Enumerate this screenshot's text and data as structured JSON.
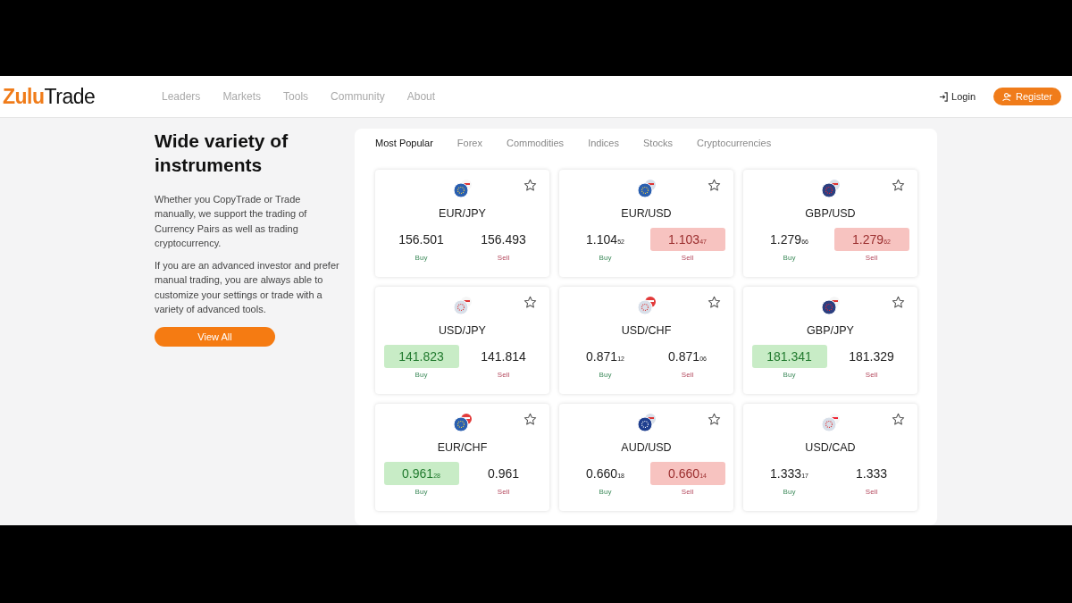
{
  "header": {
    "logo": {
      "accent": "Zulu",
      "rest": "Trade"
    },
    "nav": [
      {
        "label": "Leaders"
      },
      {
        "label": "Markets"
      },
      {
        "label": "Tools"
      },
      {
        "label": "Community"
      },
      {
        "label": "About"
      }
    ],
    "login": "Login",
    "register": "Register"
  },
  "intro": {
    "title": "Wide variety of instruments",
    "paragraphs": [
      "Whether you CopyTrade or Trade manually, we support the trading of Currency Pairs as well as trading cryptocurrency.",
      "If you are an advanced investor and prefer manual trading, you are always able to customize your settings or trade with a variety of advanced tools."
    ],
    "button": "View All"
  },
  "tabs": [
    {
      "label": "Most Popular",
      "selected": true
    },
    {
      "label": "Forex",
      "selected": false
    },
    {
      "label": "Commodities",
      "selected": false
    },
    {
      "label": "Indices",
      "selected": false
    },
    {
      "label": "Stocks",
      "selected": false
    },
    {
      "label": "Cryptocurrencies",
      "selected": false
    }
  ],
  "instruments": [
    {
      "pair": "EUR/JPY",
      "buy": {
        "price": "156.501",
        "label": "Buy",
        "highlighted": false
      },
      "sell": {
        "price": "156.493",
        "label": "Sell",
        "highlighted": false
      }
    },
    {
      "pair": "EUR/USD",
      "buy": {
        "price": "1.104$_{52}$",
        "label": "Buy",
        "highlighted": false
      },
      "sell": {
        "price": "1.103$_{47}$",
        "label": "Sell",
        "highlighted": true
      }
    },
    {
      "pair": "GBP/USD",
      "buy": {
        "price": "1.279$_{66}$",
        "label": "Buy",
        "highlighted": false
      },
      "sell": {
        "price": "1.279$_{62}$",
        "label": "Sell",
        "highlighted": true
      }
    },
    {
      "pair": "USD/JPY",
      "buy": {
        "price": "141.823",
        "label": "Buy",
        "highlighted": true
      },
      "sell": {
        "price": "141.814",
        "label": "Sell",
        "highlighted": false
      }
    },
    {
      "pair": "USD/CHF",
      "buy": {
        "price": "0.871$_{12}$",
        "label": "Buy",
        "highlighted": false
      },
      "sell": {
        "price": "0.871$_{06}$",
        "label": "Sell",
        "highlighted": false
      }
    },
    {
      "pair": "GBP/JPY",
      "buy": {
        "price": "181.341",
        "label": "Buy",
        "highlighted": true
      },
      "sell": {
        "price": "181.329",
        "label": "Sell",
        "highlighted": false
      }
    },
    {
      "pair": "EUR/CHF",
      "buy": {
        "price": "0.961$_{28}$",
        "label": "Buy",
        "highlighted": true
      },
      "sell": {
        "price": "0.961",
        "label": "Sell",
        "highlighted": false
      }
    },
    {
      "pair": "AUD/USD",
      "buy": {
        "price": "0.660$_{18}$",
        "label": "Buy",
        "highlighted": false
      },
      "sell": {
        "price": "0.660$_{14}$",
        "label": "Sell",
        "highlighted": true
      }
    },
    {
      "pair": "USD/CAD",
      "buy": {
        "price": "1.333$_{17}$",
        "label": "Buy",
        "highlighted": false
      },
      "sell": {
        "price": "1.333",
        "label": "Sell",
        "highlighted": false
      }
    }
  ]
}
